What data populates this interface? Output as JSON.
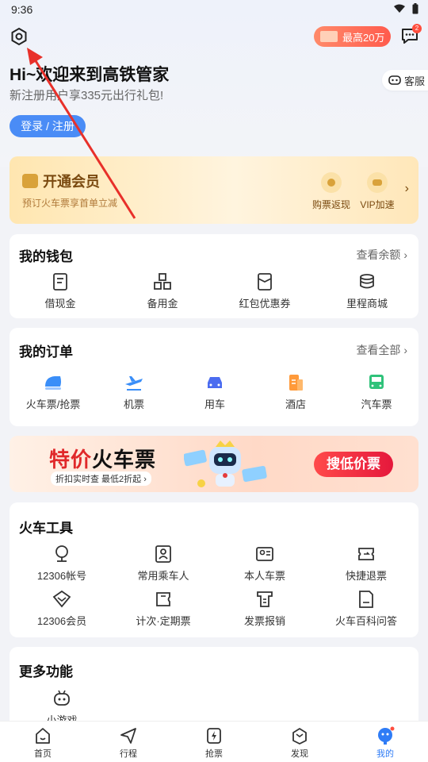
{
  "status_bar": {
    "time": "9:36"
  },
  "header": {
    "promo_label": "最高20万",
    "message_badge": "2",
    "service_label": "客服"
  },
  "welcome": {
    "title": "Hi~欢迎来到高铁管家",
    "subtitle": "新注册用户享335元出行礼包!",
    "login_label": "登录 / 注册"
  },
  "vip": {
    "title": "开通会员",
    "desc": "预订火车票享首单立减",
    "benefits": [
      {
        "label": "购票返现",
        "icon": "coin-icon"
      },
      {
        "label": "VIP加速",
        "icon": "speed-icon"
      }
    ]
  },
  "wallet": {
    "title": "我的钱包",
    "more": "查看余额",
    "items": [
      {
        "label": "借现金",
        "icon": "cash-doc-icon"
      },
      {
        "label": "备用金",
        "icon": "blocks-icon"
      },
      {
        "label": "红包优惠券",
        "icon": "envelope-icon"
      },
      {
        "label": "里程商城",
        "icon": "coins-stack-icon"
      }
    ]
  },
  "orders": {
    "title": "我的订单",
    "more": "查看全部",
    "items": [
      {
        "label": "火车票/抢票",
        "icon": "train-icon"
      },
      {
        "label": "机票",
        "icon": "plane-icon"
      },
      {
        "label": "用车",
        "icon": "car-icon"
      },
      {
        "label": "酒店",
        "icon": "hotel-icon"
      },
      {
        "label": "汽车票",
        "icon": "bus-icon"
      }
    ]
  },
  "banner": {
    "title_red": "特价",
    "title_black": "火车票",
    "subtitle": "折扣实时查 最低2折起",
    "button": "搜低价票"
  },
  "tools": {
    "title": "火车工具",
    "items": [
      {
        "label": "12306帐号",
        "icon": "account-icon"
      },
      {
        "label": "常用乘车人",
        "icon": "passenger-icon"
      },
      {
        "label": "本人车票",
        "icon": "id-ticket-icon"
      },
      {
        "label": "快捷退票",
        "icon": "refund-icon"
      },
      {
        "label": "12306会员",
        "icon": "vip-diamond-icon"
      },
      {
        "label": "计次·定期票",
        "icon": "count-ticket-icon"
      },
      {
        "label": "发票报销",
        "icon": "invoice-icon"
      },
      {
        "label": "火车百科问答",
        "icon": "wiki-icon"
      }
    ]
  },
  "more": {
    "title": "更多功能",
    "items": [
      {
        "label": "小游戏",
        "icon": "game-icon"
      }
    ]
  },
  "tabbar": {
    "items": [
      {
        "label": "首页",
        "icon": "home-icon"
      },
      {
        "label": "行程",
        "icon": "trip-icon"
      },
      {
        "label": "抢票",
        "icon": "grab-ticket-icon"
      },
      {
        "label": "发现",
        "icon": "discover-icon"
      },
      {
        "label": "我的",
        "icon": "profile-icon"
      }
    ],
    "active": "我的"
  },
  "colors": {
    "accent": "#2f7cf6",
    "login": "#4a8cf6",
    "annotation_arrow": "#e8302a"
  }
}
